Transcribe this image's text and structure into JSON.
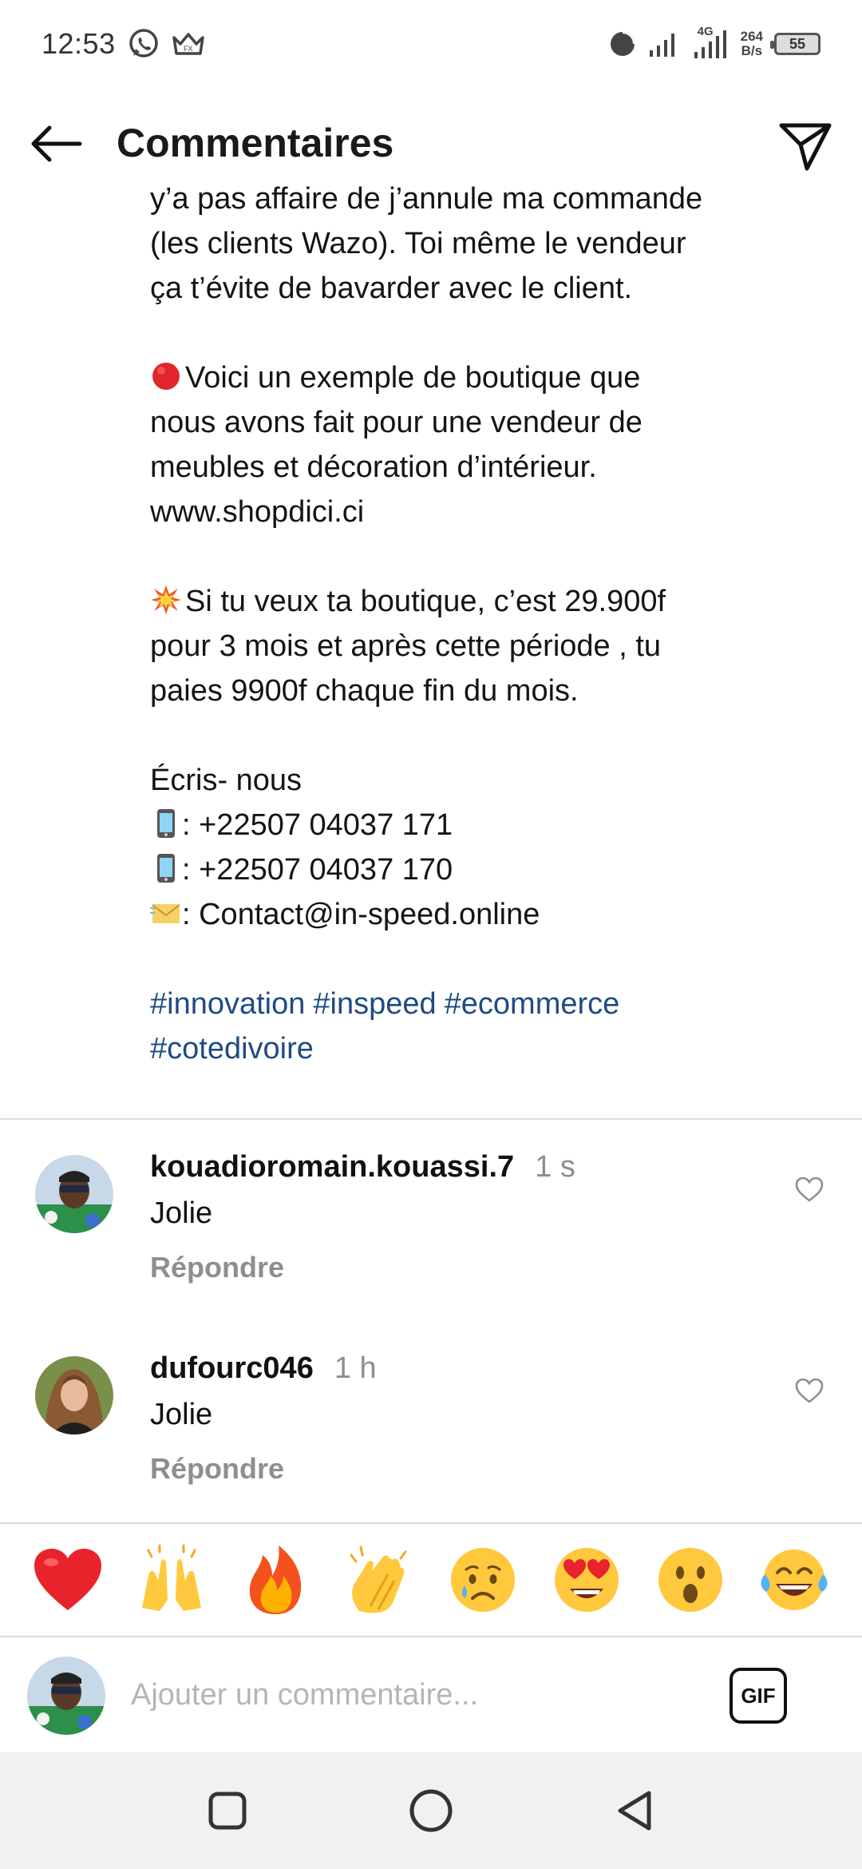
{
  "status_bar": {
    "time": "12:53",
    "network": "4G",
    "speed_value": "264",
    "speed_unit": "B/s",
    "battery": "55",
    "icons": [
      "whatsapp-icon",
      "crown-icon",
      "pie-icon",
      "signal-icon",
      "signal-4g-icon",
      "battery-icon"
    ]
  },
  "header": {
    "title": "Commentaires",
    "back_icon": "arrow-left-icon",
    "share_icon": "paper-plane-icon"
  },
  "caption": {
    "lines_top": [
      "y’a pas affaire de j’annule ma commande",
      "(les clients Wazo). Toi même le vendeur",
      "ça t’évite de bavarder avec le client."
    ],
    "example_lines": [
      "Voici un exemple de boutique que",
      "nous avons fait pour une vendeur de",
      "meubles et décoration d’intérieur.",
      "www.shopdici.ci"
    ],
    "offer_lines": [
      "Si tu veux ta boutique, c’est 29.900f",
      "pour 3 mois et après cette période , tu",
      "paies 9900f chaque fin du mois."
    ],
    "contact_title": "Écris- nous",
    "phone1": ": +22507 04037 171",
    "phone2": ": +22507 04037 170",
    "email": ": Contact@in-speed.online",
    "hashtags": [
      "#innovation",
      "#inspeed",
      "#ecommerce",
      "#cotedivoire"
    ],
    "emoji_icons": [
      "red-circle-icon",
      "collision-icon",
      "mobile-phone-icon",
      "envelope-icon"
    ]
  },
  "comments": [
    {
      "username": "kouadioromain.kouassi.7",
      "time": "1 s",
      "text": "Jolie",
      "reply_label": "Répondre"
    },
    {
      "username": "dufourc046",
      "time": "1 h",
      "text": "Jolie",
      "reply_label": "Répondre"
    }
  ],
  "reactions": [
    "heart-emoji",
    "raising-hands-emoji",
    "fire-emoji",
    "clapping-hands-emoji",
    "sad-tear-emoji",
    "heart-eyes-emoji",
    "surprised-emoji",
    "tears-of-joy-emoji"
  ],
  "composer": {
    "placeholder": "Ajouter un commentaire...",
    "gif_label": "GIF"
  },
  "nav_bar": {
    "icons": [
      "recent-apps-icon",
      "home-icon",
      "back-icon"
    ]
  },
  "colors": {
    "hashtag": "#1f4b82",
    "muted": "#8e8e8e",
    "divider": "#dbdbdb",
    "nav_background": "#f1f1f1"
  }
}
